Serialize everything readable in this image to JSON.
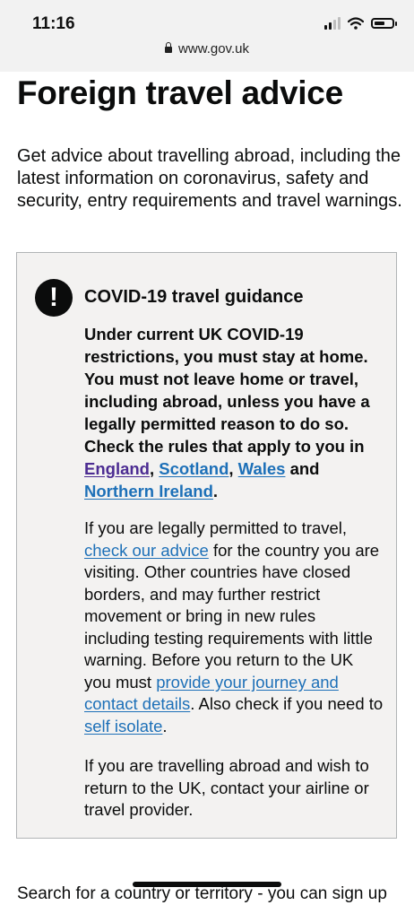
{
  "status_bar": {
    "time": "11:16",
    "url": "www.gov.uk"
  },
  "page": {
    "title": "Foreign travel advice",
    "lead": "Get advice about travelling abroad, including the latest information on coronavirus, safety and security, entry requirements and travel warnings."
  },
  "notice": {
    "icon_text": "!",
    "title": "COVID-19 travel guidance",
    "strong_text": "Under current UK COVID-19 restrictions, you must stay at home. You must not leave home or travel, including abroad, unless you have a legally permitted reason to do so. Check the rules that apply to you in",
    "links": {
      "england": "England",
      "scotland": "Scotland",
      "wales": "Wales",
      "northern_ireland": "Northern Ireland"
    },
    "sep_comma": ", ",
    "sep_and": " and ",
    "end_period": ".",
    "p1": {
      "intro": "If you are legally permitted to travel, ",
      "link1": "check our advice",
      "mid": " for the country you are visiting. Other countries have closed borders, and may further restrict movement or bring in new rules including testing requirements with little warning. Before you return to the UK you must ",
      "link2": "provide your journey and contact details",
      "mid2": ". Also check if you need to ",
      "link3": "self isolate",
      "end": "."
    },
    "p2": "If you are travelling abroad and wish to return to the UK, contact your airline or travel provider."
  },
  "footer_text": "Search for a country or territory - you can sign up",
  "colors": {
    "link": "#1d70b8",
    "visited_link": "#4c2c92",
    "text": "#0b0c0c",
    "notice_bg": "#f3f2f1"
  }
}
